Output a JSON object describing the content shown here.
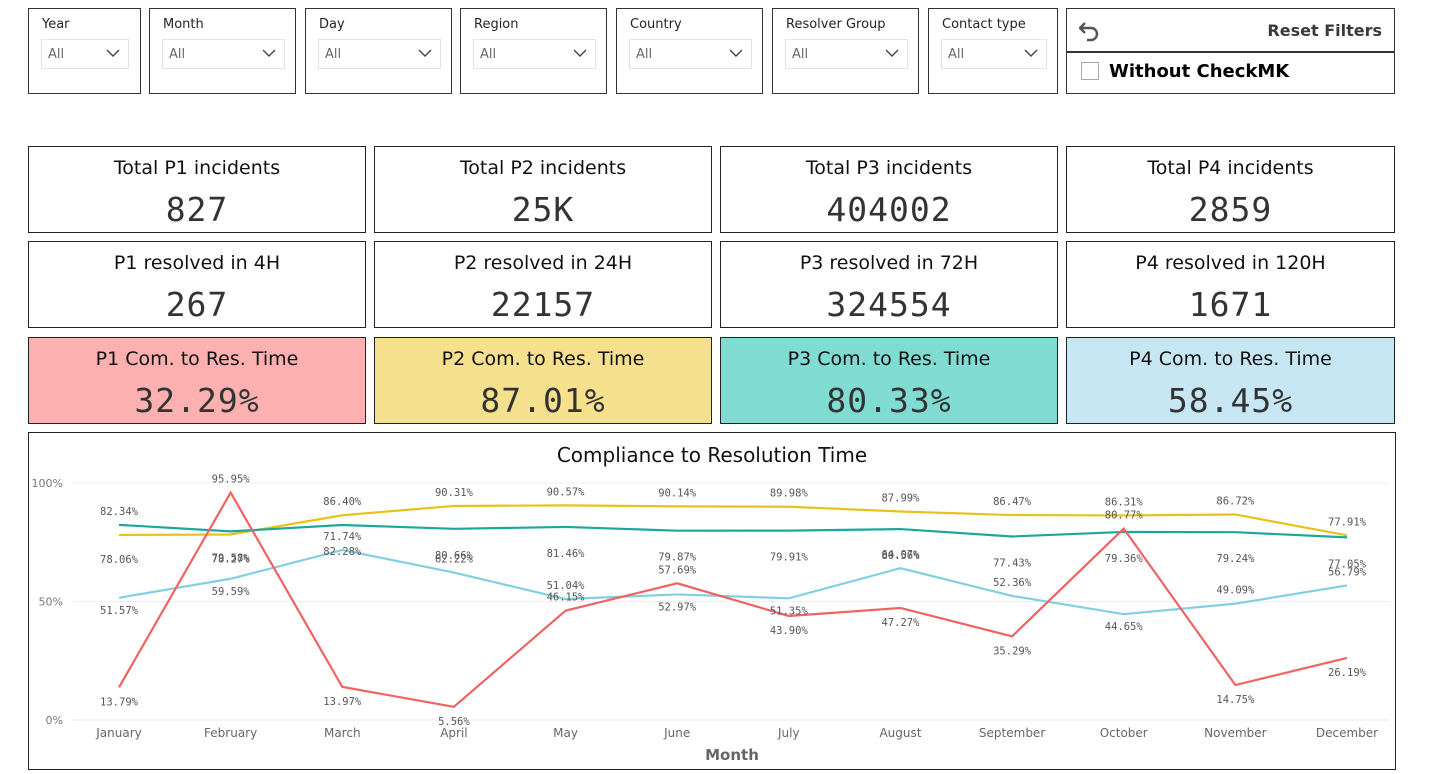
{
  "slicers": [
    {
      "label": "Year",
      "value": "All"
    },
    {
      "label": "Month",
      "value": "All"
    },
    {
      "label": "Day",
      "value": "All"
    },
    {
      "label": "Region",
      "value": "All"
    },
    {
      "label": "Country",
      "value": "All"
    },
    {
      "label": "Resolver Group",
      "value": "All"
    },
    {
      "label": "Contact type",
      "value": "All"
    }
  ],
  "reset": {
    "label": "Reset Filters",
    "checkbox_label": "Without CheckMK",
    "checked": false
  },
  "incidents": [
    {
      "title": "Total P1 incidents",
      "value": "827"
    },
    {
      "title": "Total P2 incidents",
      "value": "25K"
    },
    {
      "title": "Total P3 incidents",
      "value": "404002"
    },
    {
      "title": "Total P4 incidents",
      "value": "2859"
    }
  ],
  "resolved": [
    {
      "title": "P1 resolved in 4H",
      "value": "267"
    },
    {
      "title": "P2 resolved in 24H",
      "value": "22157"
    },
    {
      "title": "P3 resolved in 72H",
      "value": "324554"
    },
    {
      "title": "P4 resolved in 120H",
      "value": "1671"
    }
  ],
  "compliance": [
    {
      "title": "P1 Com. to Res. Time",
      "value": "32.29%",
      "color": "#fdb0b0"
    },
    {
      "title": "P2 Com. to Res. Time",
      "value": "87.01%",
      "color": "#f5e08d"
    },
    {
      "title": "P3 Com. to Res. Time",
      "value": "80.33%",
      "color": "#80dbd3"
    },
    {
      "title": "P4 Com. to Res. Time",
      "value": "58.45%",
      "color": "#c6e6f3"
    }
  ],
  "chart_data": {
    "type": "line",
    "title": "Compliance to Resolution Time",
    "xlabel": "Month",
    "ylabel": "",
    "ylim": [
      0,
      100
    ],
    "yticks": [
      "0%",
      "50%",
      "100%"
    ],
    "categories": [
      "January",
      "February",
      "March",
      "April",
      "May",
      "June",
      "July",
      "August",
      "September",
      "October",
      "November",
      "December"
    ],
    "series": [
      {
        "color": "#e8c21a",
        "values": [
          78.06,
          78.27,
          86.4,
          90.31,
          90.57,
          90.14,
          89.98,
          87.99,
          86.47,
          86.31,
          86.72,
          77.91
        ],
        "labels": [
          "78.06%",
          "78.27%",
          "86.40%",
          "90.31%",
          "90.57%",
          "90.14%",
          "89.98%",
          "87.99%",
          "86.47%",
          "86.31%",
          "86.72%",
          "77.91%"
        ]
      },
      {
        "color": "#1aa89a",
        "values": [
          82.34,
          79.58,
          82.28,
          80.66,
          81.46,
          79.87,
          79.91,
          80.56,
          77.43,
          79.36,
          79.24,
          77.05
        ],
        "labels": [
          "82.34%",
          "79.58%",
          "82.28%",
          "80.66%",
          "81.46%",
          "79.87%",
          "79.91%",
          "80.56%",
          "77.43%",
          "79.36%",
          "79.24%",
          "77.05%"
        ]
      },
      {
        "color": "#82cfe2",
        "values": [
          51.57,
          59.59,
          71.74,
          62.22,
          51.04,
          52.97,
          51.35,
          64.07,
          52.36,
          44.65,
          49.09,
          56.79
        ],
        "labels": [
          "51.57%",
          "59.59%",
          "71.74%",
          "62.22%",
          "51.04%",
          "52.97%",
          "51.35%",
          "64.07%",
          "52.36%",
          "44.65%",
          "49.09%",
          "56.79%"
        ]
      },
      {
        "color": "#ef6462",
        "values": [
          13.79,
          95.95,
          13.97,
          5.56,
          46.15,
          57.69,
          43.9,
          47.27,
          35.29,
          80.77,
          14.75,
          26.19
        ],
        "labels": [
          "13.79%",
          "95.95%",
          "13.97%",
          "5.56%",
          "46.15%",
          "57.69%",
          "43.90%",
          "47.27%",
          "35.29%",
          "80.77%",
          "14.75%",
          "26.19%"
        ]
      }
    ]
  }
}
